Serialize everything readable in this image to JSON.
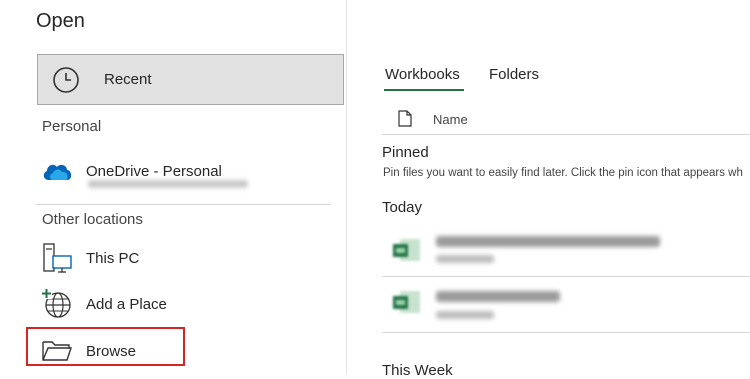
{
  "header": {
    "title": "Open"
  },
  "left": {
    "recent_label": "Recent",
    "personal_heading": "Personal",
    "onedrive_label": "OneDrive - Personal",
    "other_heading": "Other locations",
    "thispc_label": "This PC",
    "addplace_label": "Add a Place",
    "browse_label": "Browse"
  },
  "right": {
    "tabs": [
      {
        "label": "Workbooks",
        "active": true
      },
      {
        "label": "Folders",
        "active": false
      }
    ],
    "name_header": "Name",
    "pinned_heading": "Pinned",
    "pinned_desc": "Pin files you want to easily find later. Click the pin icon that appears wh",
    "today_heading": "Today",
    "this_week_heading": "This Week"
  },
  "colors": {
    "highlight_box": "#d62323",
    "excel_green": "#217346",
    "onedrive_blue": "#0364b8"
  },
  "icons": [
    "clock-icon",
    "onedrive-cloud-icon",
    "computer-icon",
    "globe-add-icon",
    "folder-icon",
    "document-icon",
    "excel-file-icon"
  ]
}
